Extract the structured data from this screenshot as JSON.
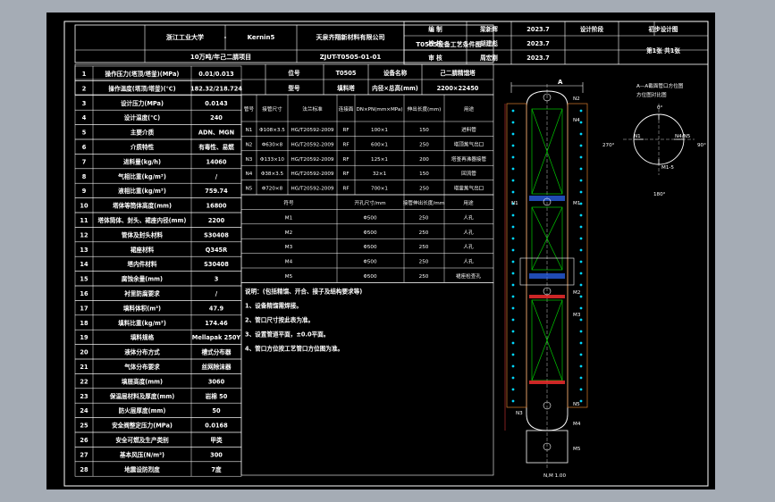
{
  "title_block": {
    "designer_label": "编 制",
    "designer": "梁新辉",
    "designer_date": "2023.7",
    "stage_label": "设计阶段",
    "stage": "初步设计图",
    "checker_label": "校 核",
    "checker": "胡建彪",
    "checker_date": "2023.7",
    "reviewer_label": "审 核",
    "reviewer": "周宏刚",
    "reviewer_date": "2023.7",
    "sheet": "第1张  共1张"
  },
  "header": {
    "school": "浙江工业大学",
    "dash": "-",
    "kernel": "Kernin5",
    "company": "天泉齐翔新材料有限公司",
    "drawing_title": "T0505设备工艺条件图",
    "project": "10万吨/年己二腈项目",
    "drawing_no": "ZJUT-T0505-01-01"
  },
  "param_rows": [
    {
      "no": "1",
      "name": "操作压力(塔顶/塔釜)(MPa)",
      "value": "0.01/0.013"
    },
    {
      "no": "2",
      "name": "操作温度(塔顶/塔釜)(℃)",
      "value": "182.32/218.724"
    },
    {
      "no": "3",
      "name": "设计压力(MPa)",
      "value": "0.0143"
    },
    {
      "no": "4",
      "name": "设计温度(℃)",
      "value": "240"
    },
    {
      "no": "5",
      "name": "主要介质",
      "value": "ADN、MGN"
    },
    {
      "no": "6",
      "name": "介质特性",
      "value": "有毒性、易燃"
    },
    {
      "no": "7",
      "name": "进料量(kg/h)",
      "value": "14060"
    },
    {
      "no": "8",
      "name": "气相比重(kg/m³)",
      "value": "/"
    },
    {
      "no": "9",
      "name": "液相比重(kg/m³)",
      "value": "759.74"
    },
    {
      "no": "10",
      "name": "塔体等筒体高度(mm)",
      "value": "16800"
    },
    {
      "no": "11",
      "name": "塔体筒体、封头、裙座内径(mm)",
      "value": "2200"
    },
    {
      "no": "12",
      "name": "管体及封头材料",
      "value": "S30408"
    },
    {
      "no": "13",
      "name": "裙座材料",
      "value": "Q345R"
    },
    {
      "no": "14",
      "name": "塔内件材料",
      "value": "S30408"
    },
    {
      "no": "15",
      "name": "腐蚀余量(mm)",
      "value": "3"
    },
    {
      "no": "16",
      "name": "衬里防腐要求",
      "value": "/"
    },
    {
      "no": "17",
      "name": "填料体积(m³)",
      "value": "47.9"
    },
    {
      "no": "18",
      "name": "填料比重(kg/m³)",
      "value": "174.46"
    },
    {
      "no": "19",
      "name": "填料规格",
      "value": "Mellapak 250Y"
    },
    {
      "no": "20",
      "name": "液体分布方式",
      "value": "槽式分布器"
    },
    {
      "no": "21",
      "name": "气体分布要求",
      "value": "丝网除沫器"
    },
    {
      "no": "22",
      "name": "填层高度(mm)",
      "value": "3060"
    },
    {
      "no": "23",
      "name": "保温层材料及厚度(mm)",
      "value": "岩棉  50"
    },
    {
      "no": "24",
      "name": "防火层厚度(mm)",
      "value": "50"
    },
    {
      "no": "25",
      "name": "安全阀整定压力(MPa)",
      "value": "0.0168"
    },
    {
      "no": "26",
      "name": "安全可燃及生产类别",
      "value": "甲类"
    },
    {
      "no": "27",
      "name": "基本风压(N/m²)",
      "value": "300"
    },
    {
      "no": "28",
      "name": "地震设防烈度",
      "value": "7度"
    }
  ],
  "device": {
    "tag_label": "位号",
    "tag": "T0505",
    "name_label": "设备名称",
    "name": "己二腈精馏塔",
    "type_label": "型号",
    "type_value": "填料塔",
    "size_label": "内径×总高(mm)",
    "size": "2200×22450"
  },
  "nozzle_headers": {
    "code": "管号",
    "size": "接管尺寸",
    "standard": "法兰标准",
    "face": "连接面",
    "dn": "DN×PN(mm×MPa)",
    "length": "伸出长度(mm)",
    "purpose": "用途"
  },
  "nozzles": [
    {
      "code": "N1",
      "size": "Φ108×3.5",
      "standard": "HG/T20592-2009",
      "face": "RF",
      "dn": "100×1",
      "length": "150",
      "purpose": "进料管"
    },
    {
      "code": "N2",
      "size": "Φ630×8",
      "standard": "HG/T20592-2009",
      "face": "RF",
      "dn": "600×1",
      "length": "250",
      "purpose": "塔顶蒸气出口"
    },
    {
      "code": "N3",
      "size": "Φ133×10",
      "standard": "HG/T20592-2009",
      "face": "RF",
      "dn": "125×1",
      "length": "200",
      "purpose": "塔釜再沸器接管"
    },
    {
      "code": "N4",
      "size": "Φ38×3.5",
      "standard": "HG/T20592-2009",
      "face": "RF",
      "dn": "32×1",
      "length": "150",
      "purpose": "回流管"
    },
    {
      "code": "N5",
      "size": "Φ720×8",
      "standard": "HG/T20592-2009",
      "face": "RF",
      "dn": "700×1",
      "length": "250",
      "purpose": "塔釜蒸气出口"
    }
  ],
  "manhole_headers": {
    "code": "符号",
    "size": "开孔尺寸/mm",
    "length": "接管伸出长度/mm",
    "purpose": "用途"
  },
  "manholes": [
    {
      "code": "M1",
      "size": "Φ500",
      "length": "250",
      "purpose": "人孔"
    },
    {
      "code": "M2",
      "size": "Φ500",
      "length": "250",
      "purpose": "人孔"
    },
    {
      "code": "M3",
      "size": "Φ500",
      "length": "250",
      "purpose": "人孔"
    },
    {
      "code": "M4",
      "size": "Φ500",
      "length": "250",
      "purpose": "人孔"
    },
    {
      "code": "M5",
      "size": "Φ500",
      "length": "250",
      "purpose": "裙座检查孔"
    }
  ],
  "notes": {
    "title": "说明：(包括精馏、开合、接子及结构要求等)",
    "items": [
      "1、设备精馏需焊接。",
      "2、管口尺寸按此表为准。",
      "3、设置管道平面，±0.0平面。",
      "4、管口方位按工艺管口方位图为准。"
    ]
  },
  "elevation": {
    "top_marker": "A",
    "section_title": "A—A截面管口方位图",
    "section_subtitle": "方位图对比图",
    "ang_0": "0°",
    "ang_90": "90°",
    "ang_180": "180°",
    "ang_270": "270°",
    "bottom_label": "N,M 1.00",
    "labels": [
      "N2",
      "N4",
      "N1",
      "M1",
      "M2",
      "M3",
      "N5",
      "M4",
      "N3",
      "M5",
      "N4/N5",
      "M1-5"
    ]
  },
  "colors": {
    "sheet": "#000000",
    "frame": "#ffffff",
    "column_red": "#ff3030",
    "column_green": "#00c800",
    "column_orange": "#d77c2c",
    "column_cyan": "#00d8ff",
    "dim_red": "#ff4040"
  }
}
